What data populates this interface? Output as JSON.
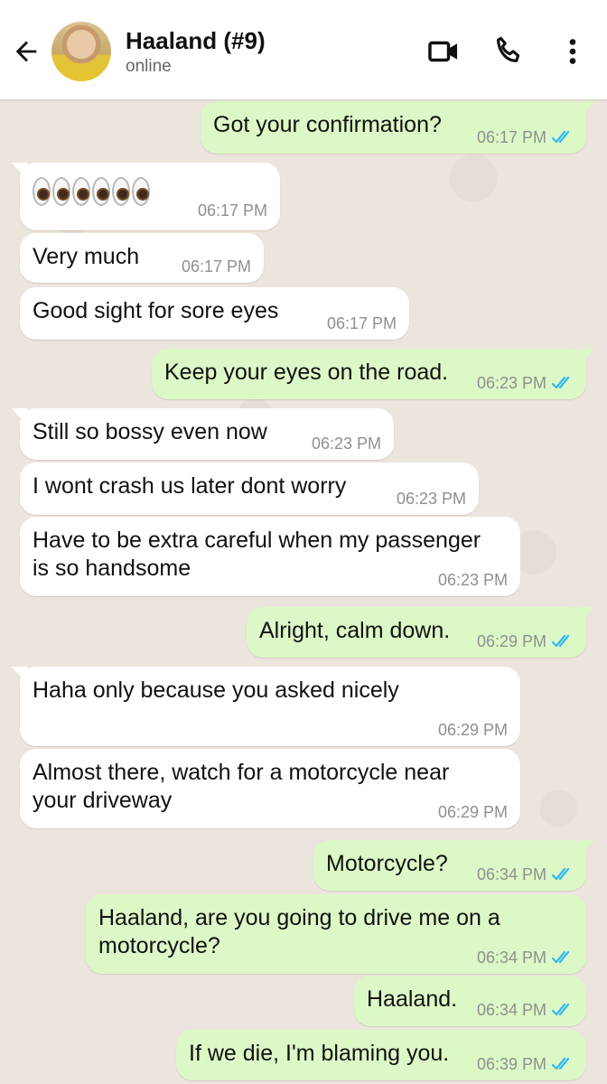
{
  "header": {
    "contact_name": "Haaland (#9)",
    "status": "online",
    "icons": {
      "back": "arrow-left-icon",
      "video": "video-call-icon",
      "call": "phone-icon",
      "menu": "more-vert-icon"
    }
  },
  "messages": [
    {
      "dir": "out",
      "text": "Got your confirmation?",
      "time": "06:17 PM",
      "ticks": "double-check-read"
    },
    {
      "dir": "in",
      "text": "👀👀👀",
      "time": "06:17 PM"
    },
    {
      "dir": "in",
      "text": "Very much",
      "time": "06:17 PM"
    },
    {
      "dir": "in",
      "text": "Good sight for sore eyes",
      "time": "06:17 PM"
    },
    {
      "dir": "out",
      "text": "Keep your eyes on the road.",
      "time": "06:23 PM",
      "ticks": "double-check-read"
    },
    {
      "dir": "in",
      "text": "Still so bossy even now",
      "time": "06:23 PM"
    },
    {
      "dir": "in",
      "text": "I wont crash us later dont worry",
      "time": "06:23 PM"
    },
    {
      "dir": "in",
      "text_lines": [
        "Have to be extra careful when my passenger",
        "is so handsome"
      ],
      "time": "06:23 PM"
    },
    {
      "dir": "out",
      "text": "Alright, calm down.",
      "time": "06:29 PM",
      "ticks": "double-check-read"
    },
    {
      "dir": "in",
      "text": "Haha only because you asked nicely",
      "time": "06:29 PM"
    },
    {
      "dir": "in",
      "text_lines": [
        "Almost there, watch for a motorcycle near",
        "your driveway"
      ],
      "time": "06:29 PM"
    },
    {
      "dir": "out",
      "text": "Motorcycle?",
      "time": "06:34 PM",
      "ticks": "double-check-read"
    },
    {
      "dir": "out",
      "text_lines": [
        "Haaland, are you going to drive me on a",
        "motorcycle?"
      ],
      "time": "06:34 PM",
      "ticks": "double-check-read"
    },
    {
      "dir": "out",
      "text": "Haaland.",
      "time": "06:34 PM",
      "ticks": "double-check-read"
    },
    {
      "dir": "out",
      "text": "If we die, I'm blaming you.",
      "time": "06:39 PM",
      "ticks": "double-check-read"
    }
  ],
  "colors": {
    "incoming_bubble": "#ffffff",
    "outgoing_bubble": "#dcf8c6",
    "chat_background": "#ece5dd",
    "read_ticks": "#34b7f1"
  }
}
